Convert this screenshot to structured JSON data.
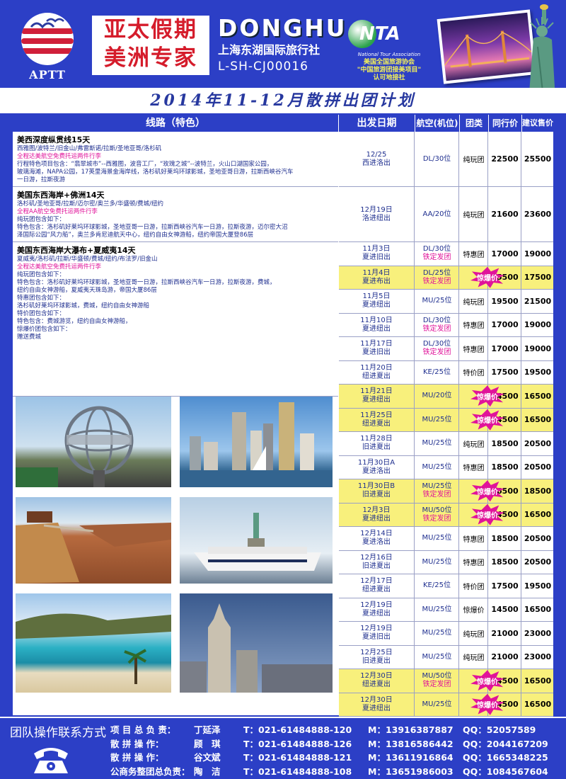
{
  "header": {
    "logo_text": "APTT",
    "brand_line1": "亚太假期",
    "brand_line2": "美洲专家",
    "agency_en": "DONGHU",
    "agency_cn": "上海东湖国际旅行社",
    "license": "L-SH-CJ00016",
    "nta_logo": "NTA",
    "nta_sub": "National Tour Association",
    "nta_line1": "美国全国旅游协会",
    "nta_line2": "\"中国旅游团接美项目\"",
    "nta_line3": "认可地接社"
  },
  "plan_title": "2014年11-12月散拼出团计划",
  "columns": {
    "route": "线路（特色）",
    "date": "出发日期",
    "airline": "航空(机位)",
    "type": "团类",
    "price": "同行价",
    "suggested": "建议售价"
  },
  "routes": [
    {
      "title": "美西深度纵贯线15天",
      "lines": [
        {
          "text": "西雅图/波特兰/旧金山/弗雷斯诺/拉斯/圣地亚哥/洛杉矶",
          "pink": false
        },
        {
          "text": "全程达美航空免费托运两件行李",
          "pink": true
        },
        {
          "text": "行程特色项目包含：“翡翠城市”--西雅图，波音工厂，“玫瑰之城”--波特兰，火山口湖国家公园，",
          "pink": false
        },
        {
          "text": "玻璃海滩，NAPA公园，17英里海景金海岸线，洛杉矶好莱坞环球影城，圣地亚哥日游，拉斯西峡谷汽车",
          "pink": false
        },
        {
          "text": "一日游，拉斯夜游",
          "pink": false
        }
      ]
    },
    {
      "title": "美国东西海岸+佛洲14天",
      "lines": [
        {
          "text": "洛杉矶/圣地亚哥/拉斯/迈尔密/奥兰多/华盛顿/费城/纽约",
          "pink": false
        },
        {
          "text": "全程AA航空免费托运两件行李",
          "pink": true
        },
        {
          "text": "纯玩团包含如下：",
          "pink": false
        },
        {
          "text": "特色包含：洛杉矶好莱坞环球影城，圣地亚哥一日游，拉斯西峡谷汽车一日游，拉斯夜游，迈尔密大沼",
          "pink": false
        },
        {
          "text": "泽国际公园“风力船”，奥兰多肯尼迪航天中心，纽约自由女神游船，纽约帝国大厦登86层",
          "pink": false
        }
      ]
    },
    {
      "title": "美国东西海岸大瀑布+夏威夷14天",
      "lines": [
        {
          "text": "夏威夷/洛杉矶/拉斯/华盛顿/费城/纽约/布法罗/旧金山",
          "pink": false
        },
        {
          "text": "全程达美航空免费托运两件行李",
          "pink": true
        },
        {
          "text": "纯玩团包含如下：",
          "pink": false
        },
        {
          "text": "特色包含：洛杉矶好莱坞环球影城，圣地亚哥一日游，拉斯西峡谷汽车一日游，拉斯夜游，费城，",
          "pink": false
        },
        {
          "text": "纽约自由女神游船，夏威夷天珠岛游，帝国大厦86层",
          "pink": false
        },
        {
          "text": "特惠团包含如下：",
          "pink": false
        },
        {
          "text": "洛杉矶好莱坞环球影城，费城，纽约自由女神游船",
          "pink": false
        },
        {
          "text": "特价团包含如下：",
          "pink": false
        },
        {
          "text": "特色包含：费城游览，纽约自由女神游船，",
          "pink": false
        },
        {
          "text": "惊爆价团包含如下：",
          "pink": false
        },
        {
          "text": "赠送费城",
          "pink": false
        }
      ]
    }
  ],
  "departures": [
    {
      "date": "12/25",
      "route": "西进洛出",
      "airline": "DL/30位",
      "note": "",
      "type": "纯玩团",
      "burst": false,
      "price": "22500",
      "suggested": "25500",
      "highlight": false
    },
    {
      "date": "12月19日",
      "route": "洛进纽出",
      "airline": "AA/20位",
      "note": "",
      "type": "纯玩团",
      "burst": false,
      "price": "21600",
      "suggested": "23600",
      "highlight": false
    },
    {
      "date": "11月3日",
      "route": "夏进旧出",
      "airline": "DL/30位",
      "note": "铁定发团",
      "type": "特惠团",
      "burst": false,
      "price": "17000",
      "suggested": "19000",
      "highlight": false
    },
    {
      "date": "11月4日",
      "route": "夏进布出",
      "airline": "DL/25位",
      "note": "铁定发团",
      "type": "惊爆价",
      "burst": true,
      "price": "15500",
      "suggested": "17500",
      "highlight": true
    },
    {
      "date": "11月5日",
      "route": "夏进纽出",
      "airline": "MU/25位",
      "note": "",
      "type": "纯玩团",
      "burst": false,
      "price": "19500",
      "suggested": "21500",
      "highlight": false
    },
    {
      "date": "11月10日",
      "route": "夏进纽出",
      "airline": "DL/30位",
      "note": "铁定发团",
      "type": "特惠团",
      "burst": false,
      "price": "17000",
      "suggested": "19000",
      "highlight": false
    },
    {
      "date": "11月17日",
      "route": "夏进旧出",
      "airline": "DL/30位",
      "note": "铁定发团",
      "type": "特惠团",
      "burst": false,
      "price": "17000",
      "suggested": "19000",
      "highlight": false
    },
    {
      "date": "11月20日",
      "route": "纽进夏出",
      "airline": "KE/25位",
      "note": "",
      "type": "特价团",
      "burst": false,
      "price": "17500",
      "suggested": "19500",
      "highlight": false
    },
    {
      "date": "11月21日",
      "route": "夏进纽出",
      "airline": "MU/20位",
      "note": "",
      "type": "惊爆价",
      "burst": true,
      "price": "14500",
      "suggested": "16500",
      "highlight": true
    },
    {
      "date": "11月25日",
      "route": "纽进夏出",
      "airline": "MU/25位",
      "note": "",
      "type": "惊爆价",
      "burst": true,
      "price": "14500",
      "suggested": "16500",
      "highlight": true
    },
    {
      "date": "11月28日",
      "route": "旧进夏出",
      "airline": "MU/25位",
      "note": "",
      "type": "纯玩团",
      "burst": false,
      "price": "18500",
      "suggested": "20500",
      "highlight": false
    },
    {
      "date": "11月30日A",
      "route": "夏进洛出",
      "airline": "MU/25位",
      "note": "",
      "type": "特惠团",
      "burst": false,
      "price": "18500",
      "suggested": "20500",
      "highlight": false
    },
    {
      "date": "11月30日B",
      "route": "旧进夏出",
      "airline": "MU/25位",
      "note": "铁定发团",
      "type": "惊爆价",
      "burst": true,
      "price": "16500",
      "suggested": "18500",
      "highlight": true
    },
    {
      "date": "12月3日",
      "route": "夏进纽出",
      "airline": "MU/50位",
      "note": "铁定发团",
      "type": "惊爆价",
      "burst": true,
      "price": "14500",
      "suggested": "16500",
      "highlight": true
    },
    {
      "date": "12月14日",
      "route": "夏进洛出",
      "airline": "MU/25位",
      "note": "",
      "type": "特惠团",
      "burst": false,
      "price": "18500",
      "suggested": "20500",
      "highlight": false
    },
    {
      "date": "12月16日",
      "route": "旧进夏出",
      "airline": "MU/25位",
      "note": "",
      "type": "特惠团",
      "burst": false,
      "price": "18500",
      "suggested": "20500",
      "highlight": false
    },
    {
      "date": "12月17日",
      "route": "纽进夏出",
      "airline": "KE/25位",
      "note": "",
      "type": "特价团",
      "burst": false,
      "price": "17500",
      "suggested": "19500",
      "highlight": false
    },
    {
      "date": "12月19日",
      "route": "夏进纽出",
      "airline": "MU/25位",
      "note": "",
      "type": "惊爆价",
      "burst": false,
      "price": "14500",
      "suggested": "16500",
      "highlight": false
    },
    {
      "date": "12月19日",
      "route": "夏进旧出",
      "airline": "MU/25位",
      "note": "",
      "type": "纯玩团",
      "burst": false,
      "price": "21000",
      "suggested": "23000",
      "highlight": false
    },
    {
      "date": "12月25日",
      "route": "旧进夏出",
      "airline": "MU/25位",
      "note": "",
      "type": "纯玩团",
      "burst": false,
      "price": "21000",
      "suggested": "23000",
      "highlight": false
    },
    {
      "date": "12月30日",
      "route": "纽进夏出",
      "airline": "MU/50位",
      "note": "铁定发团",
      "type": "惊爆价",
      "burst": true,
      "price": "14500",
      "suggested": "16500",
      "highlight": true
    },
    {
      "date": "12月30日",
      "route": "夏进纽出",
      "airline": "MU/25位",
      "note": "",
      "type": "惊爆价",
      "burst": true,
      "price": "14500",
      "suggested": "16500",
      "highlight": true
    }
  ],
  "photos": [
    "universal-studios-globe",
    "san-diego-skyline",
    "grand-canyon-skywalk",
    "statue-of-liberty-cruise",
    "hawaii-beach",
    "chrysler-building"
  ],
  "footer": {
    "title": "团队操作联系方式",
    "contacts": [
      {
        "role": "项 目 总 负 责：",
        "name": "丁延泽",
        "tel": "T：021-61484888-120",
        "mobile": "M：13916387887",
        "qq": "QQ：52057589"
      },
      {
        "role": "散 拼 操 作：",
        "name": "顾　琪",
        "tel": "T：021-61484888-126",
        "mobile": "M：13816586442",
        "qq": "QQ：2044167209"
      },
      {
        "role": "散 拼 操 作：",
        "name": "谷文斌",
        "tel": "T：021-61484888-121",
        "mobile": "M：13611916864",
        "qq": "QQ：1665348225"
      },
      {
        "role": "公商务整团总负责：",
        "name": "陶　洁",
        "tel": "T：021-61484888-108",
        "mobile": "M：13651986003",
        "qq": "QQ：1084567604"
      }
    ]
  },
  "colors": {
    "background": "#2c3fc6",
    "highlight": "#f8f07c",
    "accent": "#e0139a",
    "brand_red": "#d51c2b"
  }
}
